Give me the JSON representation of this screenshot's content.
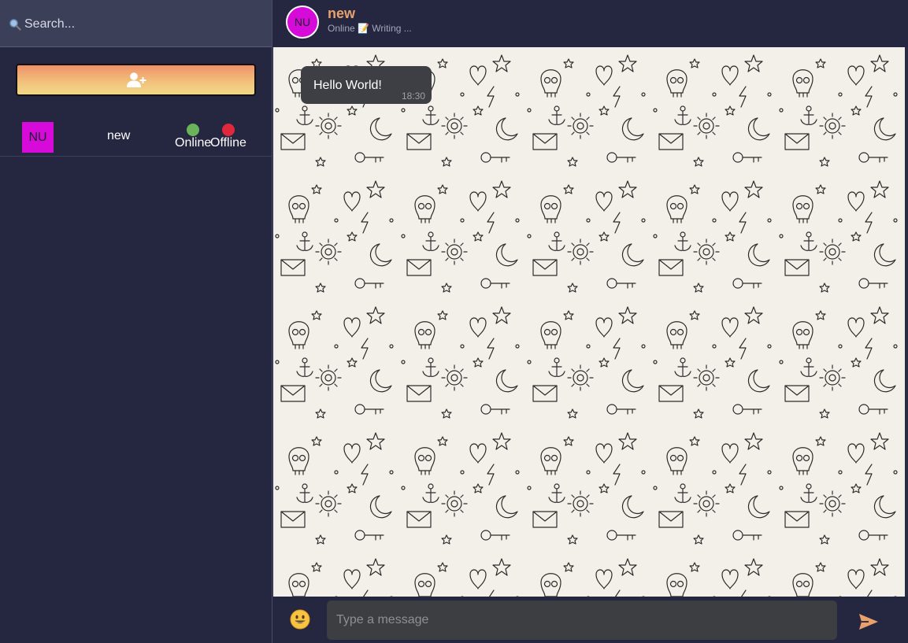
{
  "sidebar": {
    "search": {
      "icon": "search-icon",
      "placeholder": "Search..."
    },
    "add_button": {
      "icon": "add-user-icon"
    },
    "contacts": [
      {
        "initials": "NU",
        "name": "new",
        "status_online_label": "Online",
        "status_offline_label": "Offline",
        "avatar_color": "#d60ad9"
      }
    ]
  },
  "chat": {
    "header": {
      "initials": "NU",
      "name": "new",
      "status": "Online 📝 Writing ..."
    },
    "messages": [
      {
        "text": "Hello World!",
        "time": "18:30"
      }
    ],
    "composer": {
      "emoji_icon": "emoji-icon",
      "placeholder": "Type a message",
      "send_icon": "send-icon"
    }
  },
  "colors": {
    "sidebar_bg": "#252640",
    "search_bg": "#3c3f58",
    "accent": "#e9a16c",
    "avatar": "#d60ad9",
    "online": "#6bb35a",
    "offline": "#e0283c",
    "chat_bg": "#f3f0ea",
    "bubble_bg": "#3e3f44"
  }
}
